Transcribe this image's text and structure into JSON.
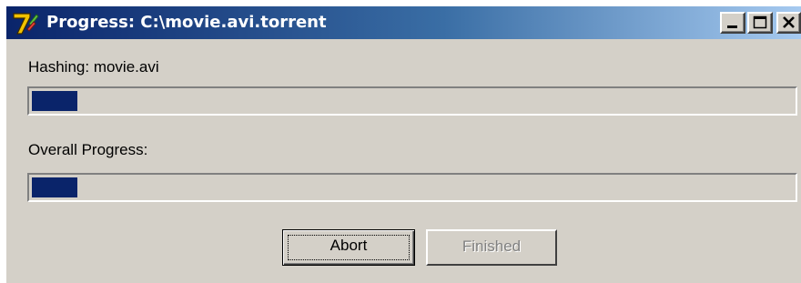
{
  "window": {
    "title": "Progress: C:\\movie.avi.torrent",
    "icon": "7-zip-app-icon",
    "caption_buttons": [
      "minimize-icon",
      "maximize-icon",
      "close-icon"
    ]
  },
  "hashing": {
    "label": "Hashing: movie.avi",
    "progress_percent": 6
  },
  "overall": {
    "label": "Overall Progress:",
    "progress_percent": 6
  },
  "buttons": {
    "abort_label": "Abort",
    "finished_label": "Finished",
    "finished_enabled": false
  },
  "colors": {
    "titlebar_start": "#0a246a",
    "titlebar_end": "#a6caf0",
    "progress_fill": "#0a246a",
    "face": "#d4d0c8"
  }
}
